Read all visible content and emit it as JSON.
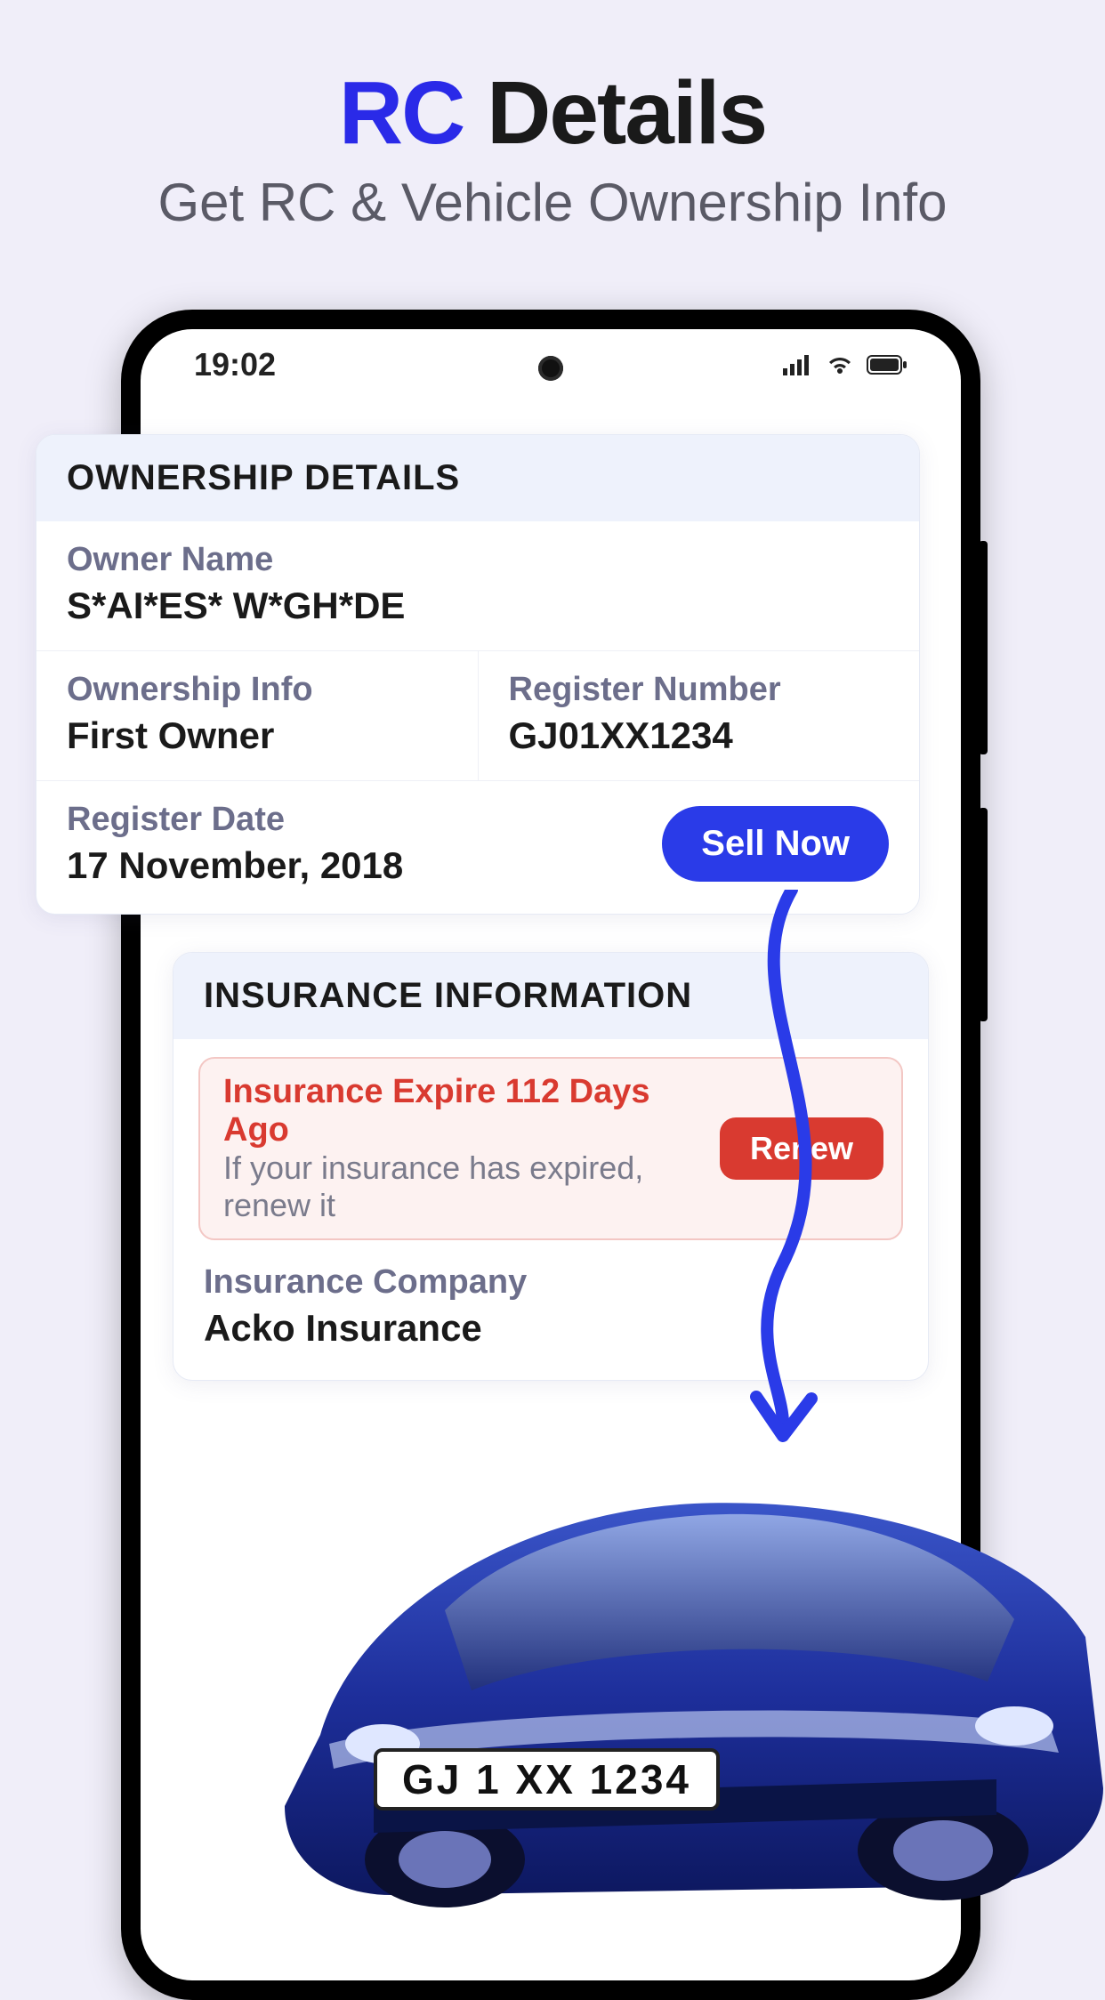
{
  "hero": {
    "title_accent": "RC",
    "title_rest": " Details",
    "subtitle": "Get RC & Vehicle Ownership Info"
  },
  "status": {
    "time": "19:02"
  },
  "ownership": {
    "header": "OWNERSHIP DETAILS",
    "owner_label": "Owner Name",
    "owner_value": "S*AI*ES* W*GH*DE",
    "info_label": "Ownership Info",
    "info_value": "First Owner",
    "regnum_label": "Register Number",
    "regnum_value": "GJ01XX1234",
    "regdate_label": "Register Date",
    "regdate_value": "17 November, 2018",
    "sell_label": "Sell Now"
  },
  "insurance": {
    "header": "INSURANCE INFORMATION",
    "alert_title": "Insurance Expire 112 Days Ago",
    "alert_sub": "If your insurance has expired, renew it",
    "renew_label": "Renew",
    "company_label": "Insurance Company",
    "company_value": "Acko Insurance"
  },
  "plate": "GJ 1 XX 1234"
}
